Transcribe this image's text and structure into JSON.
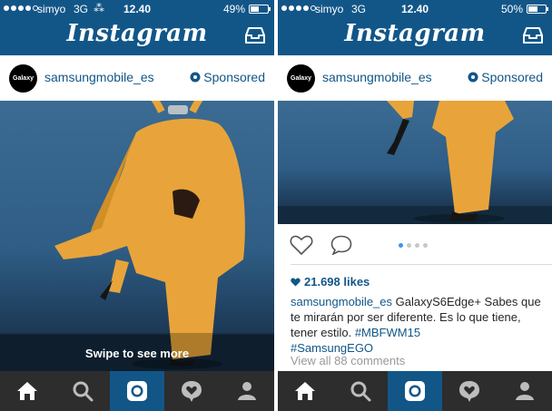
{
  "colors": {
    "header_blue": "#125688",
    "tabbar_dark": "#2d2d2d",
    "link_blue": "#125688",
    "carousel_active": "#3897f0"
  },
  "left": {
    "status": {
      "carrier": "simyo",
      "network": "3G",
      "spinner": "⁂",
      "time": "12.40",
      "battery": "49%",
      "battery_level": 0.49
    },
    "app_title": "Instagram",
    "profile": {
      "avatar_text": "Galaxy",
      "username": "samsungmobile_es",
      "sponsored": "Sponsored"
    },
    "photo_overlay": "Swipe to see more",
    "tabs": [
      "home-icon",
      "search-icon",
      "camera-icon",
      "activity-icon",
      "profile-icon"
    ]
  },
  "right": {
    "status": {
      "carrier": "simyo",
      "network": "3G",
      "time": "12.40",
      "battery": "50%",
      "battery_level": 0.5
    },
    "app_title": "Instagram",
    "profile": {
      "avatar_text": "Galaxy",
      "username": "samsungmobile_es",
      "sponsored": "Sponsored"
    },
    "carousel": {
      "count": 4,
      "active": 0
    },
    "likes": "21.698 likes",
    "caption": {
      "user": "samsungmobile_es",
      "text": " GalaxyS6Edge+ Sabes que te mirarán por ser diferente. Es lo que tiene, tener estilo. ",
      "tag1": "#MBFWM15",
      "tag2": "#SamsungEGO"
    },
    "view_all": "View all 88 comments",
    "tabs": [
      "home-icon",
      "search-icon",
      "camera-icon",
      "activity-icon",
      "profile-icon"
    ]
  }
}
